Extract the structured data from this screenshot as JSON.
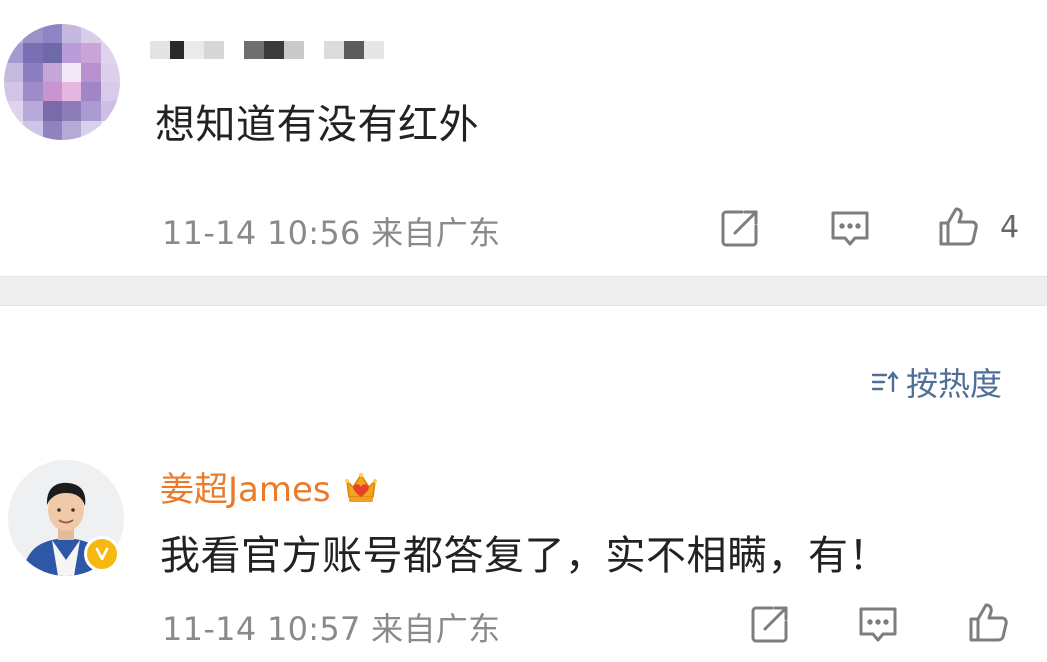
{
  "comments": [
    {
      "username": "",
      "text": "想知道有没有红外",
      "time": "11-14 10:56",
      "location": "来自广东",
      "likes": "4",
      "icons": {
        "share": "share-icon",
        "reply": "comment-icon",
        "like": "thumbs-up-icon"
      }
    },
    {
      "username": "姜超James",
      "text": "我看官方账号都答复了，实不相瞒，有！",
      "time": "11-14 10:57",
      "location": "来自广东",
      "likes": "",
      "badge": "crown-badge-icon",
      "verified": "verified-v-icon",
      "icons": {
        "share": "share-icon",
        "reply": "comment-icon",
        "like": "thumbs-up-icon"
      }
    }
  ],
  "sort": {
    "label": "按热度",
    "icon": "sort-icon"
  },
  "colors": {
    "username_accent": "#eb7a2b",
    "sort_accent": "#506e96",
    "meta_gray": "#8a8a8a",
    "divider": "#efefef",
    "verified": "#f6b90f"
  }
}
